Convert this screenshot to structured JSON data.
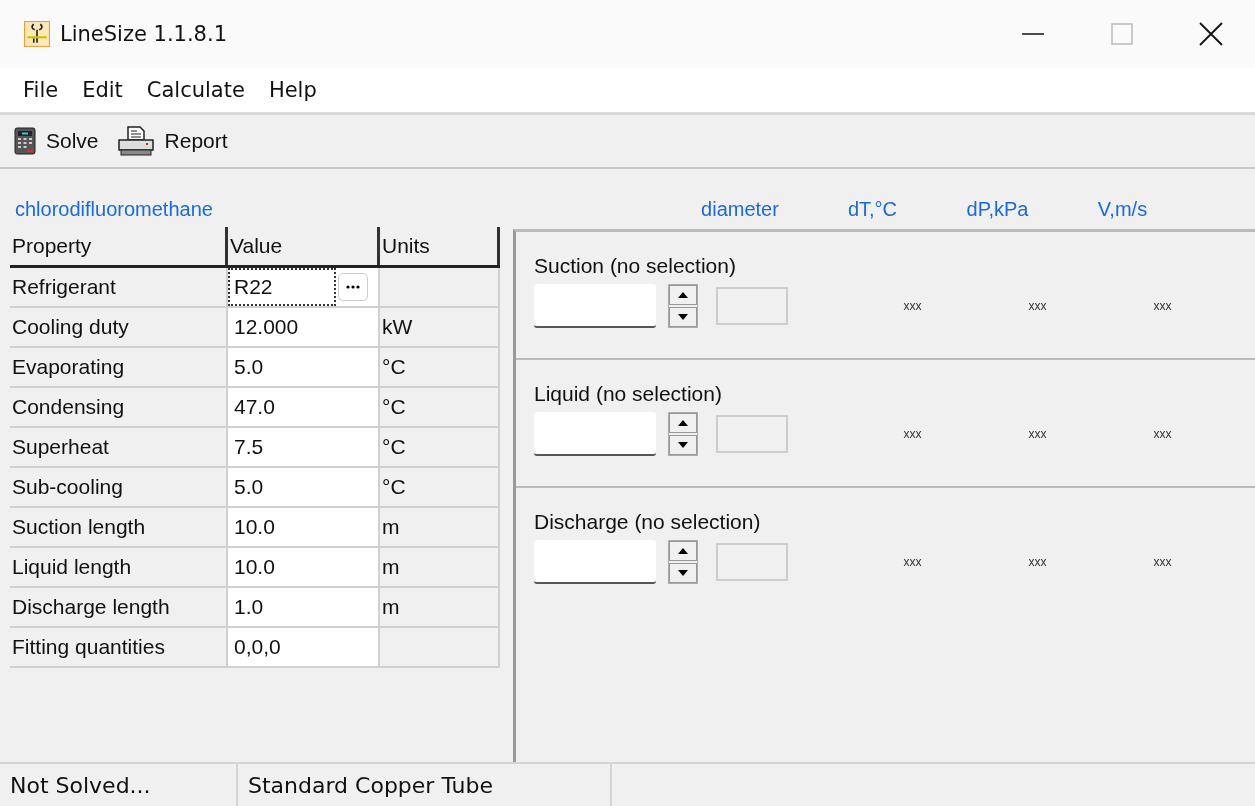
{
  "window": {
    "title": "LineSize 1.1.8.1"
  },
  "menu": [
    "File",
    "Edit",
    "Calculate",
    "Help"
  ],
  "toolbar": [
    {
      "label": "Solve",
      "kind": "calculator"
    },
    {
      "label": "Report",
      "kind": "printer"
    }
  ],
  "refrigerant_name": "chlorodifluoromethane",
  "result_columns": [
    "diameter",
    "dT,°C",
    "dP,kPa",
    "V,m/s"
  ],
  "properties": {
    "columns": [
      "Property",
      "Value",
      "Units"
    ],
    "rows": [
      {
        "property": "Refrigerant",
        "value": "R22",
        "kind": "picker"
      },
      {
        "property": "Cooling duty",
        "value": "12.000",
        "units": "kW",
        "kind": "text"
      },
      {
        "property": "Evaporating",
        "value": "5.0",
        "units": "°C",
        "kind": "text"
      },
      {
        "property": "Condensing",
        "value": "47.0",
        "units": "°C",
        "kind": "text"
      },
      {
        "property": "Superheat",
        "value": "7.5",
        "units": "°C",
        "kind": "text"
      },
      {
        "property": "Sub-cooling",
        "value": "5.0",
        "units": "°C",
        "kind": "text"
      },
      {
        "property": "Suction length",
        "value": "10.0",
        "units": "m",
        "kind": "text"
      },
      {
        "property": "Liquid length",
        "value": "10.0",
        "units": "m",
        "kind": "text"
      },
      {
        "property": "Discharge length",
        "value": "1.0",
        "units": "m",
        "kind": "text"
      },
      {
        "property": "Fitting quantities",
        "value": "0,0,0",
        "kind": "text"
      }
    ]
  },
  "lines": [
    {
      "title": "Suction (no selection)",
      "results": [
        "xxx",
        "xxx",
        "xxx"
      ]
    },
    {
      "title": "Liquid (no selection)",
      "results": [
        "xxx",
        "xxx",
        "xxx"
      ]
    },
    {
      "title": "Discharge (no selection)",
      "results": [
        "xxx",
        "xxx",
        "xxx"
      ]
    }
  ],
  "status_bar": [
    "Not Solved...",
    "Standard Copper Tube"
  ]
}
